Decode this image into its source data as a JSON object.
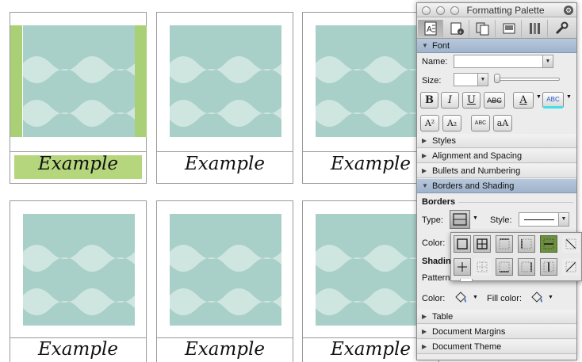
{
  "document": {
    "cards": [
      {
        "caption": "Example"
      },
      {
        "caption": "Example"
      },
      {
        "caption": "Example"
      },
      {
        "caption": "Example"
      },
      {
        "caption": "Example"
      },
      {
        "caption": "Example"
      }
    ]
  },
  "palette": {
    "title": "Formatting Palette",
    "toolbar": [
      {
        "icon": "formatting-icon",
        "selected": true
      },
      {
        "icon": "object-palette-icon",
        "selected": false
      },
      {
        "icon": "scrapbook-icon",
        "selected": false
      },
      {
        "icon": "reference-tools-icon",
        "selected": false
      },
      {
        "icon": "compatibility-icon",
        "selected": false
      },
      {
        "icon": "project-palette-icon",
        "selected": false
      }
    ],
    "font": {
      "header": "Font",
      "name_label": "Name:",
      "name_value": "",
      "size_label": "Size:",
      "size_value": "",
      "bold": "B",
      "italic": "I",
      "underline": "U",
      "strike": "ABC",
      "font_color": "A",
      "highlight": "ABC",
      "superscript": "A²",
      "subscript": "A₂",
      "small_caps": "ABC",
      "change_case": "aA"
    },
    "sections_before": [
      "Styles",
      "Alignment and Spacing",
      "Bullets and Numbering"
    ],
    "borders_shading": {
      "header": "Borders and Shading",
      "borders_title": "Borders",
      "type_label": "Type:",
      "style_label": "Style:",
      "color_label": "Color:",
      "shading_title": "Shadin",
      "pattern_label": "Pattern",
      "shading_color_label": "Color:",
      "fill_color_label": "Fill color:"
    },
    "sections_after": [
      "Table",
      "Document Margins",
      "Document Theme"
    ]
  },
  "colors": {
    "teal": "#a9d0c8",
    "wave": "#cfe6e0",
    "green": "#a9d077",
    "selected_green": "#6e8f42"
  }
}
